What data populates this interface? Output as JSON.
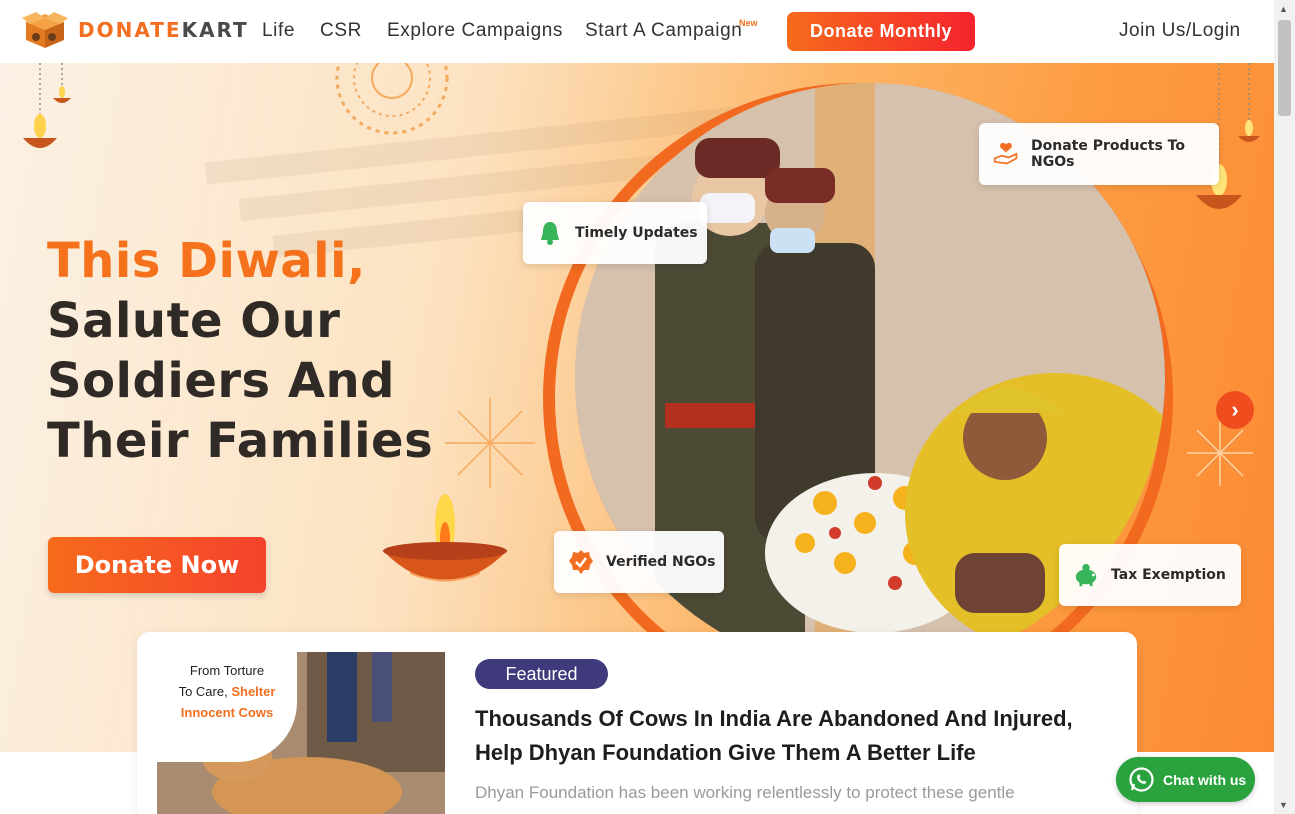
{
  "brand": {
    "name_part1": "DONATE",
    "name_part2": "KART"
  },
  "nav": {
    "items": [
      "Life",
      "CSR",
      "Explore Campaigns",
      "Start A Campaign"
    ],
    "new_tag": "New",
    "donate_monthly": "Donate Monthly",
    "login": "Join Us/Login"
  },
  "hero": {
    "title_accent": "This Diwali,",
    "title_line2": "Salute Our",
    "title_line3": "Soldiers And",
    "title_line4": "Their Families",
    "cta": "Donate Now",
    "badges": {
      "timely": "Timely Updates",
      "products": "Donate Products To NGOs",
      "verified": "Verified NGOs",
      "tax": "Tax Exemption"
    }
  },
  "featured": {
    "pill": "Featured",
    "image_caption_line1": "From Torture",
    "image_caption_line2_a": "To Care, ",
    "image_caption_line2_b": "Shelter",
    "image_caption_line3": "Innocent Cows",
    "title": "Thousands Of Cows In India Are Abandoned And Injured, Help Dhyan Foundation Give Them A Better Life",
    "description": "Dhyan Foundation has been working relentlessly to protect these gentle"
  },
  "chat": {
    "label": "Chat with us"
  },
  "colors": {
    "brand_orange": "#f26f21",
    "featured_pill": "#3e3a7b",
    "whatsapp": "#2aa33f"
  }
}
